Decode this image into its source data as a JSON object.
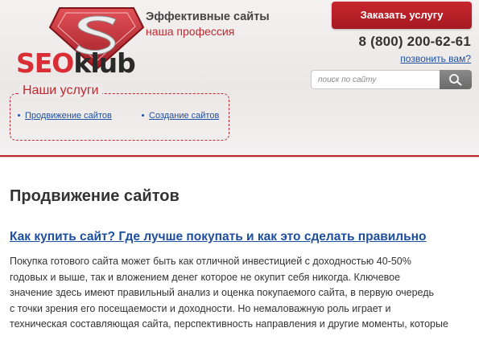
{
  "header": {
    "logo": {
      "word_seo": "SEO",
      "word_klub": "klub",
      "emblem_letter": "S"
    },
    "slogan_line1": "Эффективные сайты",
    "slogan_line2": "наша профессия",
    "order_button": "Заказать услугу",
    "phone": "8 (800) 200-62-61",
    "callback_link": "позвонить вам?",
    "search": {
      "placeholder": "поиск по сайту",
      "button_icon": "search-icon"
    }
  },
  "services": {
    "title": "Наши услуги",
    "items": [
      "Продвижение сайтов",
      "Создание сайтов"
    ]
  },
  "main": {
    "page_title": "Продвижение сайтов",
    "article_link": "Как купить сайт? Где лучше покупать и как это сделать правильно",
    "article_lines": [
      "Покупка готового сайта может быть как отличной инвестицией с доходностью 40-50%",
      "годовых и выше, так и вложением денег которое не окупит себя никогда. Ключевое",
      "значение здесь имеют правильный анализ и оценка покупаемого сайта, в первую очередь",
      "с точки зрения его посещаемости и доходности. Но немаловажную роль играет и",
      "техническая составляющая сайта, перспективность направления и другие моменты, которые"
    ]
  },
  "colors": {
    "brand_red": "#c0282f",
    "link_blue": "#1d4fa0",
    "text": "#333333"
  }
}
